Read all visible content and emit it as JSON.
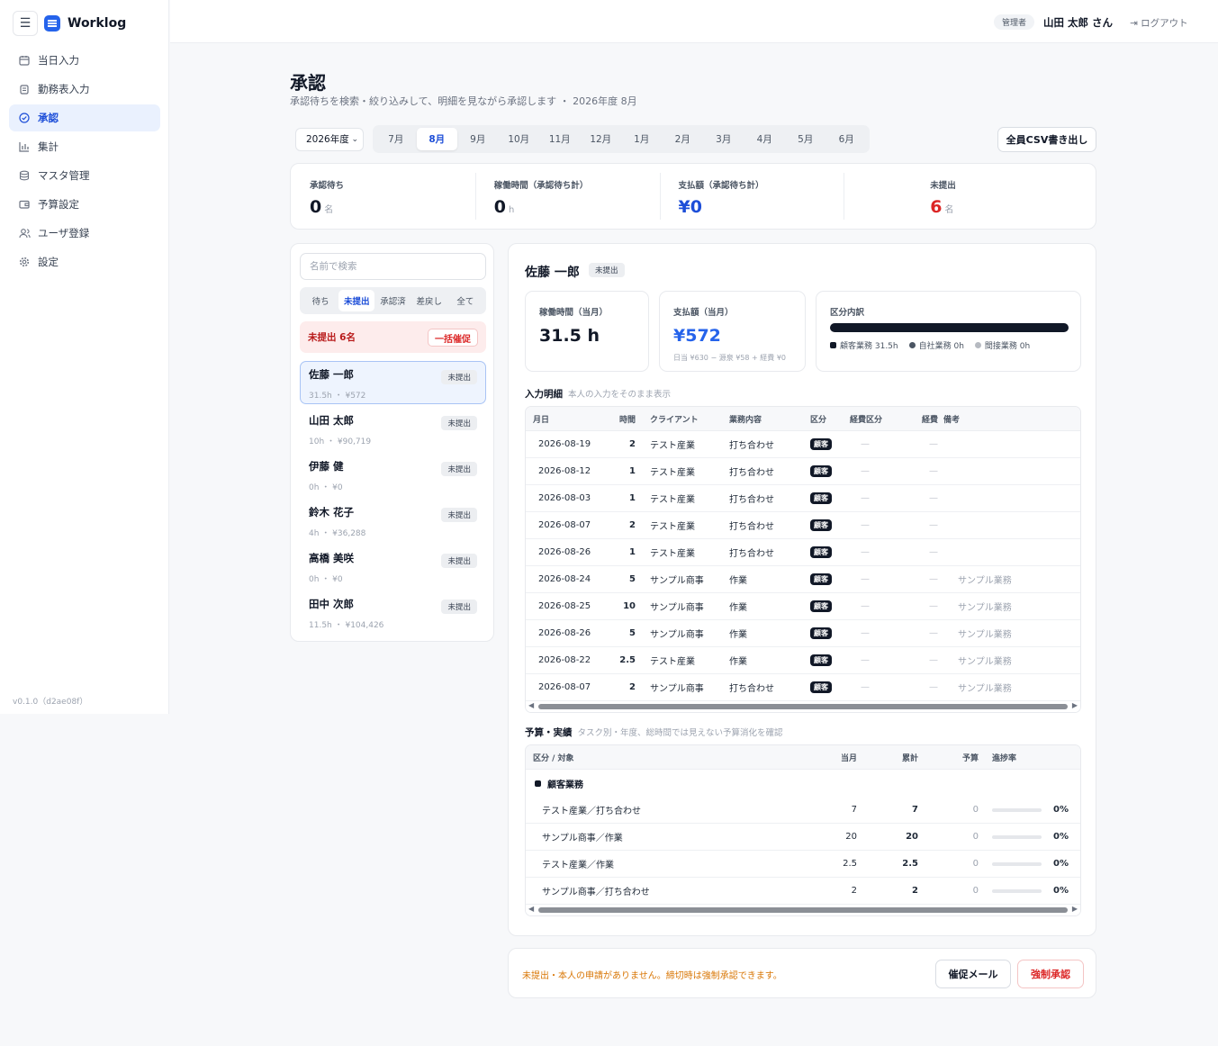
{
  "app": {
    "name": "Worklog",
    "version": "v0.1.0（d2ae08f）"
  },
  "sidebar": {
    "items": [
      {
        "label": "当日入力",
        "icon": "calendar-icon"
      },
      {
        "label": "勤務表入力",
        "icon": "clipboard-icon"
      },
      {
        "label": "承認",
        "icon": "check-circle-icon",
        "active": true
      },
      {
        "label": "集計",
        "icon": "bar-chart-icon"
      },
      {
        "label": "マスタ管理",
        "icon": "database-icon"
      },
      {
        "label": "予算設定",
        "icon": "wallet-icon"
      },
      {
        "label": "ユーザ登録",
        "icon": "users-icon"
      },
      {
        "label": "設定",
        "icon": "gear-icon"
      }
    ]
  },
  "header": {
    "role": "管理者",
    "user": "山田 太郎 さん",
    "logout": "ログアウト"
  },
  "page": {
    "title": "承認",
    "subtitle": "承認待ちを検索・絞り込みして、明細を見ながら承認します ・ 2026年度 8月"
  },
  "filters": {
    "year": "2026年度",
    "months": [
      "7月",
      "8月",
      "9月",
      "10月",
      "11月",
      "12月",
      "1月",
      "2月",
      "3月",
      "4月",
      "5月",
      "6月"
    ],
    "active_month": "8月",
    "csv_button": "全員CSV書き出し"
  },
  "stats": [
    {
      "label": "承認待ち",
      "value": "0",
      "unit": "名"
    },
    {
      "label": "稼働時間（承認待ち計）",
      "value": "0",
      "unit": "h"
    },
    {
      "label": "支払額（承認待ち計）",
      "value": "¥0",
      "unit": ""
    },
    {
      "label": "未提出",
      "value": "6",
      "unit": "名"
    }
  ],
  "list_panel": {
    "search_placeholder": "名前で検索",
    "tabs": [
      "待ち",
      "未提出",
      "承認済",
      "差戻し",
      "全て"
    ],
    "active_tab": "未提出",
    "banner": {
      "text": "未提出 6名",
      "button": "一括催促"
    },
    "people": [
      {
        "name": "佐藤 一郎",
        "meta": "31.5h ・ ¥572",
        "status": "未提出"
      },
      {
        "name": "山田 太郎",
        "meta": "10h ・ ¥90,719",
        "status": "未提出"
      },
      {
        "name": "伊藤 健",
        "meta": "0h ・ ¥0",
        "status": "未提出"
      },
      {
        "name": "鈴木 花子",
        "meta": "4h ・ ¥36,288",
        "status": "未提出"
      },
      {
        "name": "高橋 美咲",
        "meta": "0h ・ ¥0",
        "status": "未提出"
      },
      {
        "name": "田中 次郎",
        "meta": "11.5h ・ ¥104,426",
        "status": "未提出"
      }
    ]
  },
  "detail": {
    "name": "佐藤 一郎",
    "status": "未提出",
    "hours_card": {
      "label": "稼働時間（当月）",
      "value": "31.5 h"
    },
    "pay_card": {
      "label": "支払額（当月）",
      "value": "¥572",
      "note": "日当 ¥630 − 源泉 ¥58 + 経費 ¥0"
    },
    "breakdown": {
      "label": "区分内訳",
      "items": [
        {
          "label": "顧客業務 31.5h",
          "color": "#111827"
        },
        {
          "label": "自社業務 0h",
          "color": "#4b5563"
        },
        {
          "label": "間接業務 0h",
          "color": "#b6bac1"
        }
      ]
    },
    "entries_title": "入力明細",
    "entries_note": "本人の入力をそのまま表示",
    "entries_headers": [
      "月日",
      "時間",
      "クライアント",
      "業務内容",
      "区分",
      "経費区分",
      "経費",
      "備考"
    ],
    "entries": [
      {
        "date": "2026-08-19",
        "hours": "2",
        "client": "テスト産業",
        "task": "打ち合わせ",
        "cat": "顧客",
        "exp_type": "—",
        "exp": "—",
        "note": ""
      },
      {
        "date": "2026-08-12",
        "hours": "1",
        "client": "テスト産業",
        "task": "打ち合わせ",
        "cat": "顧客",
        "exp_type": "—",
        "exp": "—",
        "note": ""
      },
      {
        "date": "2026-08-03",
        "hours": "1",
        "client": "テスト産業",
        "task": "打ち合わせ",
        "cat": "顧客",
        "exp_type": "—",
        "exp": "—",
        "note": ""
      },
      {
        "date": "2026-08-07",
        "hours": "2",
        "client": "テスト産業",
        "task": "打ち合わせ",
        "cat": "顧客",
        "exp_type": "—",
        "exp": "—",
        "note": ""
      },
      {
        "date": "2026-08-26",
        "hours": "1",
        "client": "テスト産業",
        "task": "打ち合わせ",
        "cat": "顧客",
        "exp_type": "—",
        "exp": "—",
        "note": ""
      },
      {
        "date": "2026-08-24",
        "hours": "5",
        "client": "サンプル商事",
        "task": "作業",
        "cat": "顧客",
        "exp_type": "—",
        "exp": "—",
        "note": "サンプル業務"
      },
      {
        "date": "2026-08-25",
        "hours": "10",
        "client": "サンプル商事",
        "task": "作業",
        "cat": "顧客",
        "exp_type": "—",
        "exp": "—",
        "note": "サンプル業務"
      },
      {
        "date": "2026-08-26",
        "hours": "5",
        "client": "サンプル商事",
        "task": "作業",
        "cat": "顧客",
        "exp_type": "—",
        "exp": "—",
        "note": "サンプル業務"
      },
      {
        "date": "2026-08-22",
        "hours": "2.5",
        "client": "テスト産業",
        "task": "作業",
        "cat": "顧客",
        "exp_type": "—",
        "exp": "—",
        "note": "サンプル業務"
      },
      {
        "date": "2026-08-07",
        "hours": "2",
        "client": "サンプル商事",
        "task": "打ち合わせ",
        "cat": "顧客",
        "exp_type": "—",
        "exp": "—",
        "note": "サンプル業務"
      }
    ],
    "budget_title": "予算・実績",
    "budget_note": "タスク別・年度、総時間では見えない予算消化を確認",
    "budget_headers": [
      "区分 / 対象",
      "当月",
      "累計",
      "予算",
      "進捗率"
    ],
    "budget_group": "顧客業務",
    "budget_rows": [
      {
        "name": "テスト産業／打ち合わせ",
        "month": "7",
        "total": "7",
        "budget": "0",
        "rate": "0%",
        "progress": 0
      },
      {
        "name": "サンプル商事／作業",
        "month": "20",
        "total": "20",
        "budget": "0",
        "rate": "0%",
        "progress": 0
      },
      {
        "name": "テスト産業／作業",
        "month": "2.5",
        "total": "2.5",
        "budget": "0",
        "rate": "0%",
        "progress": 0
      },
      {
        "name": "サンプル商事／打ち合わせ",
        "month": "2",
        "total": "2",
        "budget": "0",
        "rate": "0%",
        "progress": 0
      }
    ]
  },
  "footer": {
    "message": "未提出・本人の申請がありません。締切時は強制承認できます。",
    "remind_button": "催促メール",
    "force_button": "強制承認"
  }
}
